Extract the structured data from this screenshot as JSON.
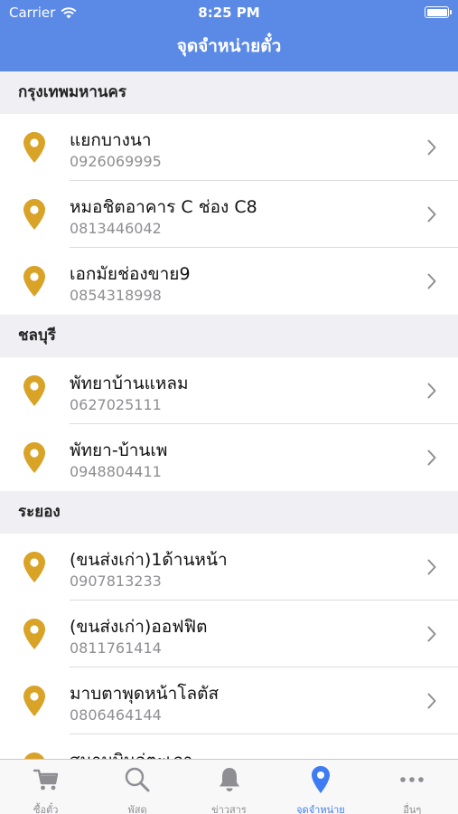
{
  "status_bar": {
    "carrier": "Carrier",
    "time": "8:25 PM"
  },
  "nav": {
    "title": "จุดจำหน่ายตั๋ว"
  },
  "colors": {
    "accent": "#5a8ae6",
    "pin": "#d8a326",
    "active_tab": "#3d7cf2"
  },
  "sections": [
    {
      "header": "กรุงเทพมหานคร",
      "items": [
        {
          "title": "แยกบางนา",
          "phone": "0926069995"
        },
        {
          "title": "หมอชิตอาคาร C ช่อง C8",
          "phone": "0813446042"
        },
        {
          "title": "เอกมัยช่องขาย9",
          "phone": "0854318998"
        }
      ]
    },
    {
      "header": "ชลบุรี",
      "items": [
        {
          "title": "พัทยาบ้านแหลม",
          "phone": "0627025111"
        },
        {
          "title": "พัทยา-บ้านเพ",
          "phone": "0948804411"
        }
      ]
    },
    {
      "header": "ระยอง",
      "items": [
        {
          "title": "(ขนส่งเก่า)1ด้านหน้า",
          "phone": "0907813233"
        },
        {
          "title": "(ขนส่งเก่า)ออฟฟิต",
          "phone": "0811761414"
        },
        {
          "title": "มาบตาพุดหน้าโลตัส",
          "phone": "0806464144"
        },
        {
          "title": "สนามบินอู่ตะเภา",
          "phone": ""
        }
      ]
    }
  ],
  "tabs": [
    {
      "label": "ซื้อตั๋ว",
      "icon": "cart-icon"
    },
    {
      "label": "พัสดุ",
      "icon": "search-icon"
    },
    {
      "label": "ข่าวสาร",
      "icon": "bell-icon"
    },
    {
      "label": "จุดจำหน่าย",
      "icon": "location-pin-icon",
      "active": true
    },
    {
      "label": "อื่นๆ",
      "icon": "more-icon"
    }
  ]
}
